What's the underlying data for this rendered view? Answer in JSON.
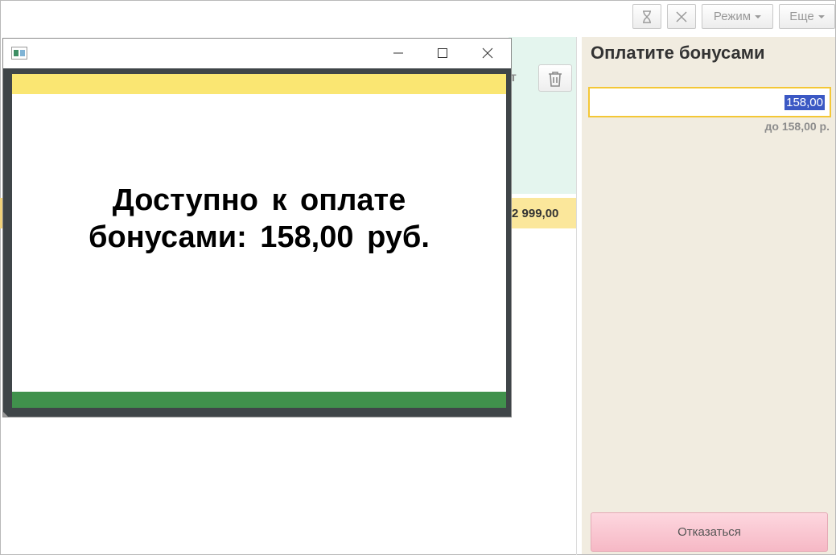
{
  "toolbar": {
    "hourglass_icon": "hourglass-icon",
    "close_icon": "close-icon",
    "mode_label": "Режим",
    "more_label": "Еще"
  },
  "background": {
    "partial_letter": "т",
    "total_amount": "2 999,00"
  },
  "right_panel": {
    "title": "Оплатите бонусами",
    "amount_value": "158,00",
    "limit_note": "до 158,00 р.",
    "cancel_label": "Отказаться"
  },
  "dialog": {
    "message_line1": "Доступно к оплате",
    "message_line2": "бонусами: 158,00 руб.",
    "colors": {
      "top_stripe": "#fae672",
      "bottom_stripe": "#40914c",
      "frame": "#3f4548"
    }
  },
  "colors": {
    "panel_bg": "#f1ece0",
    "input_border": "#f4c736",
    "selection": "#3b58c4",
    "cancel_button": "#f6b8c5",
    "background_green": "#e4f5ee",
    "background_yellow": "#fbe79b"
  }
}
